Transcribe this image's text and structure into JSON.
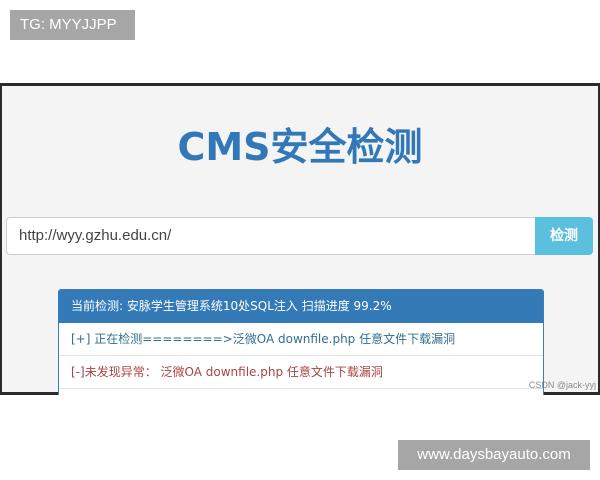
{
  "overlay": {
    "top_tag": "TG: MYYJJPP",
    "bottom_tag": "www.daysbayauto.com",
    "watermark": "CSDN @jack-yyj"
  },
  "app": {
    "title": "CMS安全检测",
    "url_input": {
      "value": "http://wyy.gzhu.edu.cn/",
      "placeholder": ""
    },
    "detect_button": "检测",
    "results": {
      "heading": "当前检测: 安脉学生管理系统10处SQL注入 扫描进度 99.2%",
      "rows": [
        {
          "text": "[+] 正在检测========>泛微OA downfile.php 任意文件下载漏洞",
          "status": "checking"
        },
        {
          "text": "[-]未发现异常：  泛微OA downfile.php 任意文件下载漏洞",
          "status": "clear"
        }
      ]
    }
  },
  "colors": {
    "accent": "#337ab7",
    "button": "#5bc0de",
    "info_text": "#31708f",
    "danger_text": "#a94442"
  }
}
